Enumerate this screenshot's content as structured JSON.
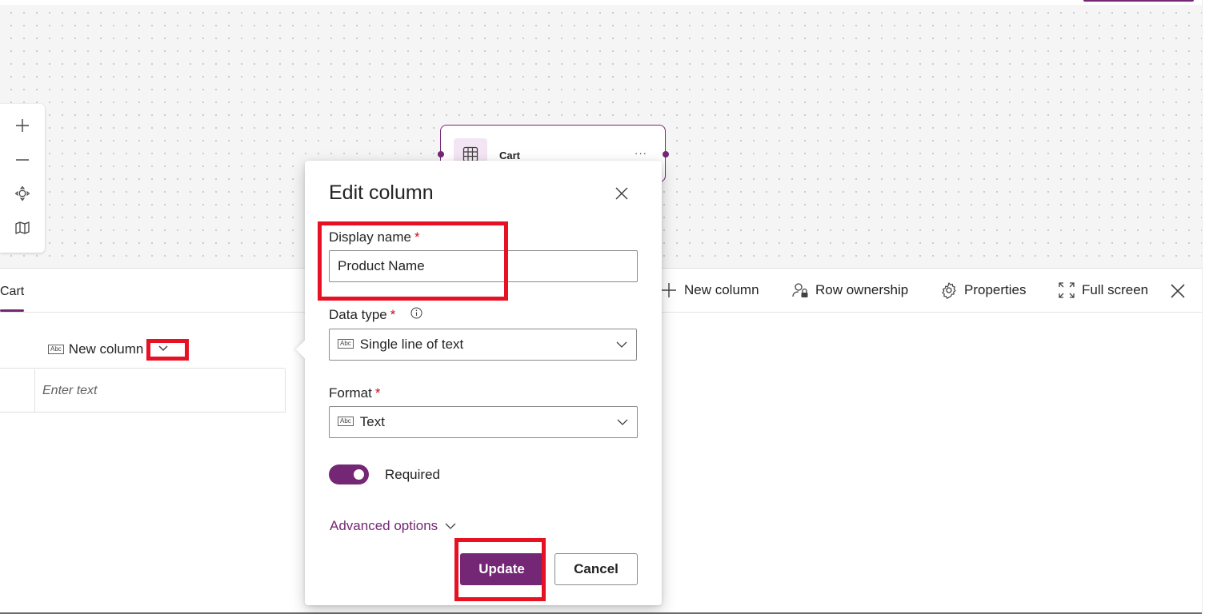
{
  "colors": {
    "accent": "#742774",
    "highlight": "#e81123",
    "required": "#c50f1f"
  },
  "canvas": {
    "zoom_controls": [
      "plus-icon",
      "minus-icon",
      "fit-view-icon",
      "map-icon"
    ],
    "table_card": {
      "name": "Cart",
      "more": "···",
      "icon": "table-icon"
    }
  },
  "table_panel": {
    "tab": "Cart",
    "commands": [
      {
        "label": "New column",
        "icon": "plus-icon"
      },
      {
        "label": "Row ownership",
        "icon": "person-lock-icon"
      },
      {
        "label": "Properties",
        "icon": "gear-icon"
      },
      {
        "label": "Full screen",
        "icon": "expand-icon"
      }
    ],
    "close_icon": "close-icon",
    "grid": {
      "column_header": "New column",
      "column_icon_text": "Abc",
      "row_placeholder": "Enter text"
    }
  },
  "dialog": {
    "title": "Edit column",
    "display_name": {
      "label": "Display name",
      "required_mark": "*",
      "value": "Product Name"
    },
    "data_type": {
      "label": "Data type",
      "required_mark": "*",
      "value": "Single line of text",
      "icon_text": "Abc"
    },
    "format": {
      "label": "Format",
      "required_mark": "*",
      "value": "Text",
      "icon_text": "Abc"
    },
    "required_toggle": {
      "label": "Required",
      "on": true
    },
    "advanced_options": "Advanced options",
    "update_button": "Update",
    "cancel_button": "Cancel"
  }
}
